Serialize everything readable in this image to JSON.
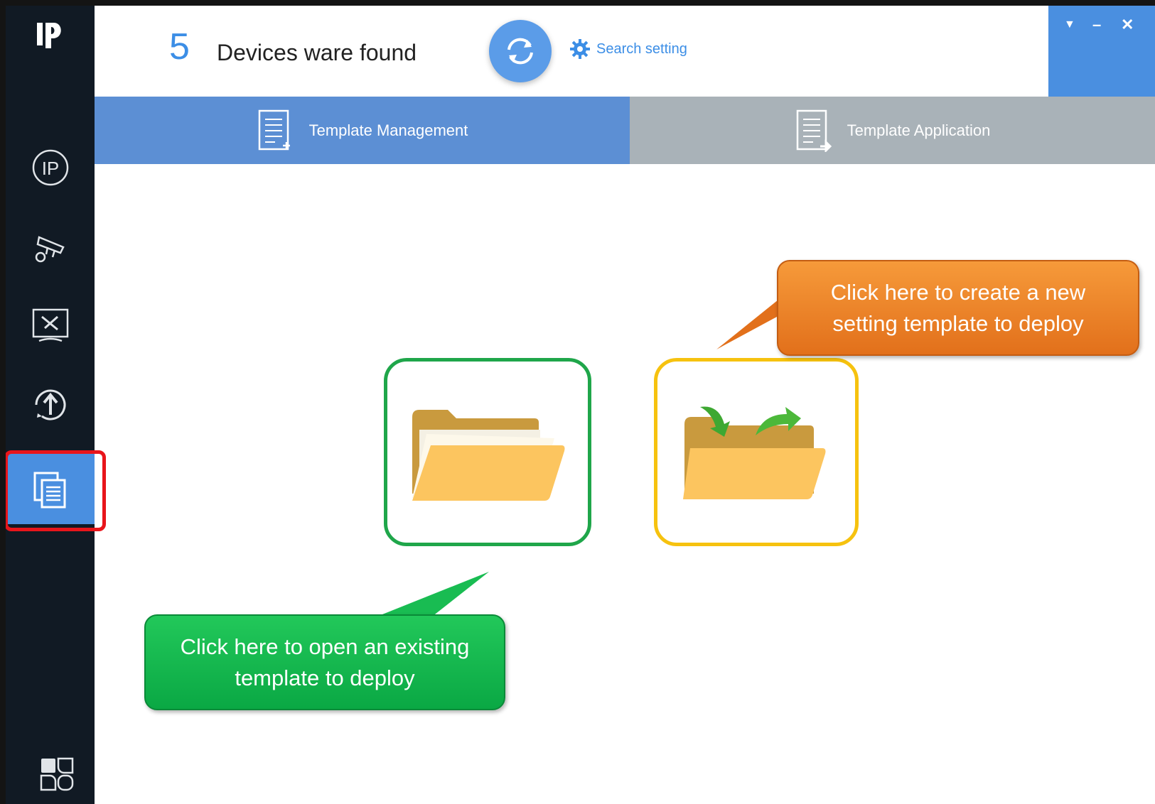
{
  "header": {
    "device_count": "5",
    "found_text": "Devices ware found",
    "search_setting": "Search setting"
  },
  "tabs": [
    {
      "label": "Template Management",
      "active": true
    },
    {
      "label": "Template Application",
      "active": false
    }
  ],
  "callouts": {
    "new_template": "Click here to create a new setting template to deploy",
    "open_template": "Click here to open an existing template to deploy"
  },
  "colors": {
    "accent": "#4a8fe0",
    "sidebar": "#111a24",
    "active_outline": "#e8151b",
    "open_box_border": "#1fa64a",
    "new_box_border": "#f6c20f"
  },
  "icons": {
    "sidebar": [
      "logo-icon",
      "ip-icon",
      "camera-settings-icon",
      "tools-icon",
      "upgrade-icon",
      "template-icon",
      "apps-icon"
    ]
  }
}
